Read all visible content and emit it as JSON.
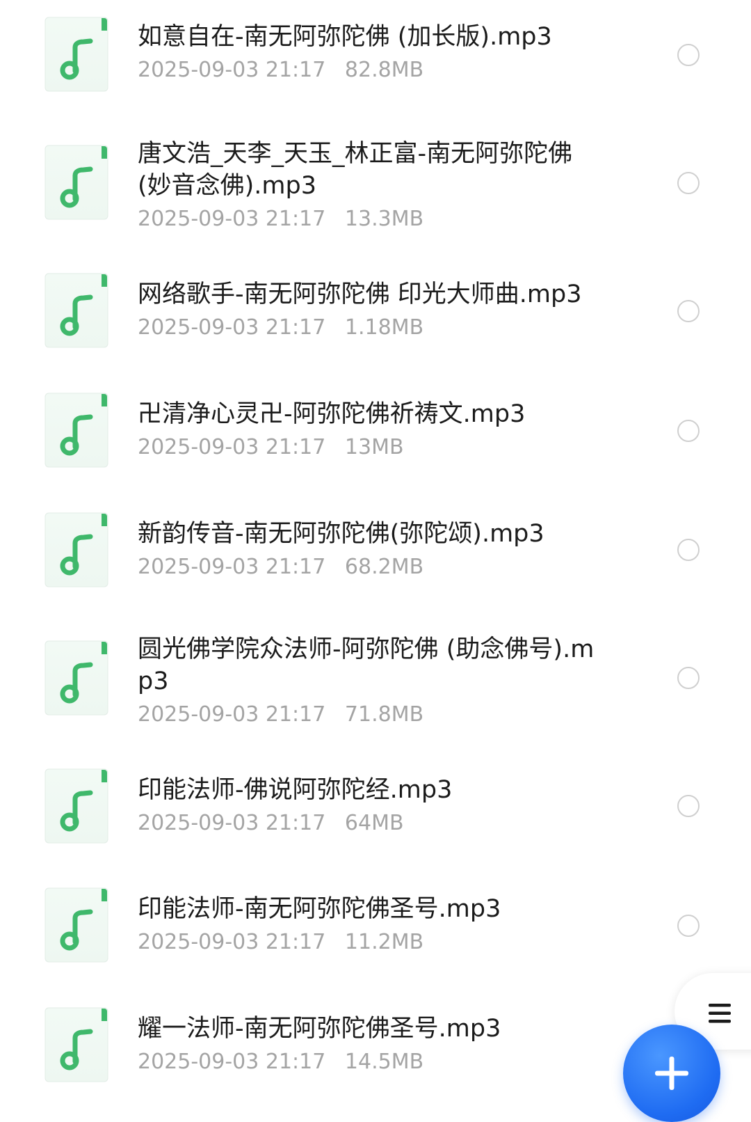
{
  "colors": {
    "accent": "#1f6cf2",
    "icon_green": "#3fb86b",
    "icon_bg": "#eef7f1",
    "name_text": "#1b1b1b",
    "meta_text": "#a4a4a4",
    "radio_border": "#cfcfcf"
  },
  "icons": {
    "file_type": "music-note-icon",
    "select": "radio-unchecked",
    "menu": "hamburger-menu-icon",
    "add": "plus-icon"
  },
  "files": [
    {
      "name": "如意自在-南无阿弥陀佛 (加长版).mp3",
      "date": "2025-09-03 21:17",
      "size": "82.8MB"
    },
    {
      "name": "唐文浩_天李_天玉_林正富-南无阿弥陀佛 (妙音念佛).mp3",
      "date": "2025-09-03 21:17",
      "size": "13.3MB"
    },
    {
      "name": "网络歌手-南无阿弥陀佛 印光大师曲.mp3",
      "date": "2025-09-03 21:17",
      "size": "1.18MB"
    },
    {
      "name": "卍清净心灵卍-阿弥陀佛祈祷文.mp3",
      "date": "2025-09-03 21:17",
      "size": "13MB"
    },
    {
      "name": "新韵传音-南无阿弥陀佛(弥陀颂).mp3",
      "date": "2025-09-03 21:17",
      "size": "68.2MB"
    },
    {
      "name": "圆光佛学院众法师-阿弥陀佛 (助念佛号).mp3",
      "date": "2025-09-03 21:17",
      "size": "71.8MB"
    },
    {
      "name": "印能法师-佛说阿弥陀经.mp3",
      "date": "2025-09-03 21:17",
      "size": "64MB"
    },
    {
      "name": "印能法师-南无阿弥陀佛圣号.mp3",
      "date": "2025-09-03 21:17",
      "size": "11.2MB"
    },
    {
      "name": "耀一法师-南无阿弥陀佛圣号.mp3",
      "date": "2025-09-03 21:17",
      "size": "14.5MB"
    }
  ]
}
